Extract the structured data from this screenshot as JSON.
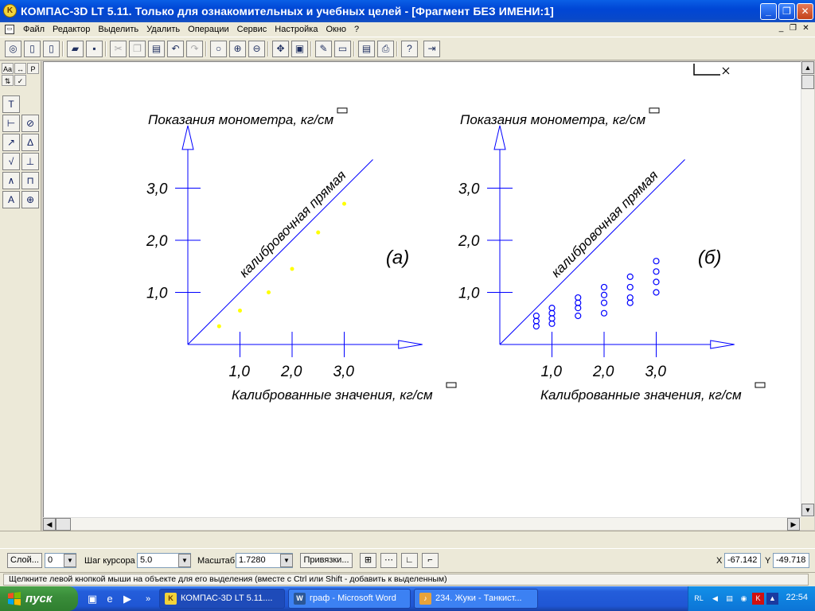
{
  "window": {
    "title": "КОМПАС-3D LT 5.11. Только для ознакомительных и учебных целей - [Фрагмент БЕЗ ИМЕНИ:1]",
    "minimize_glyph": "_",
    "maximize_glyph": "❐",
    "close_glyph": "✕"
  },
  "menu": {
    "items": [
      "Файл",
      "Редактор",
      "Выделить",
      "Удалить",
      "Операции",
      "Сервис",
      "Настройка",
      "Окно",
      "?"
    ]
  },
  "chart_data": [
    {
      "type": "scatter",
      "title": "",
      "panel_label": "(а)",
      "xlabel": "Калиброванные значения, кг/см",
      "ylabel": "Показания монометра, кг/см",
      "x_ticks": [
        "1,0",
        "2,0",
        "3,0"
      ],
      "y_ticks": [
        "1,0",
        "2,0",
        "3,0"
      ],
      "xlim": [
        0,
        4.5
      ],
      "ylim": [
        0,
        4.2
      ],
      "diagonal_label": "калибровочная прямая",
      "diagonal": {
        "x": [
          0,
          3.55
        ],
        "y": [
          0,
          3.55
        ]
      },
      "marker": "dot",
      "marker_color": "#ffff00",
      "points": [
        {
          "x": 0.6,
          "y": 0.35
        },
        {
          "x": 1.0,
          "y": 0.65
        },
        {
          "x": 1.55,
          "y": 1.0
        },
        {
          "x": 2.0,
          "y": 1.45
        },
        {
          "x": 2.5,
          "y": 2.15
        },
        {
          "x": 3.0,
          "y": 2.7
        }
      ]
    },
    {
      "type": "scatter",
      "title": "",
      "panel_label": "(б)",
      "xlabel": "Калиброванные значения, кг/см",
      "ylabel": "Показания монометра, кг/см",
      "x_ticks": [
        "1,0",
        "2,0",
        "3,0"
      ],
      "y_ticks": [
        "1,0",
        "2,0",
        "3,0"
      ],
      "xlim": [
        0,
        4.5
      ],
      "ylim": [
        0,
        4.2
      ],
      "diagonal_label": "калибровочная прямая",
      "diagonal": {
        "x": [
          0,
          3.55
        ],
        "y": [
          0,
          3.55
        ]
      },
      "marker": "circle",
      "marker_color": "#0000ff",
      "points": [
        {
          "x": 0.7,
          "y": 0.35
        },
        {
          "x": 0.7,
          "y": 0.45
        },
        {
          "x": 0.7,
          "y": 0.55
        },
        {
          "x": 1.0,
          "y": 0.4
        },
        {
          "x": 1.0,
          "y": 0.5
        },
        {
          "x": 1.0,
          "y": 0.6
        },
        {
          "x": 1.0,
          "y": 0.7
        },
        {
          "x": 1.5,
          "y": 0.55
        },
        {
          "x": 1.5,
          "y": 0.7
        },
        {
          "x": 1.5,
          "y": 0.8
        },
        {
          "x": 1.5,
          "y": 0.9
        },
        {
          "x": 2.0,
          "y": 0.6
        },
        {
          "x": 2.0,
          "y": 0.8
        },
        {
          "x": 2.0,
          "y": 0.95
        },
        {
          "x": 2.0,
          "y": 1.1
        },
        {
          "x": 2.5,
          "y": 0.8
        },
        {
          "x": 2.5,
          "y": 0.9
        },
        {
          "x": 2.5,
          "y": 1.1
        },
        {
          "x": 2.5,
          "y": 1.3
        },
        {
          "x": 3.0,
          "y": 1.0
        },
        {
          "x": 3.0,
          "y": 1.2
        },
        {
          "x": 3.0,
          "y": 1.4
        },
        {
          "x": 3.0,
          "y": 1.6
        }
      ]
    }
  ],
  "props": {
    "layer_label": "Слой...",
    "layer_value": "0",
    "step_label": "Шаг курсора",
    "step_value": "5.0",
    "scale_label": "Масштаб",
    "scale_value": "1.7280",
    "snaps_label": "Привязки...",
    "x_label": "X",
    "x_value": "-67.142",
    "y_label": "Y",
    "y_value": "-49.718"
  },
  "status": {
    "text": "Щелкните левой кнопкой мыши на объекте для его выделения (вместе с Ctrl или Shift - добавить к выделенным)"
  },
  "taskbar": {
    "start_label": "пуск",
    "tasks": [
      {
        "label": "КОМПАС-3D LT 5.11....",
        "icon_color": "#f3d33a",
        "icon_text": "K"
      },
      {
        "label": "граф - Microsoft Word",
        "icon_color": "#2b5797",
        "icon_text": "W"
      },
      {
        "label": "234. Жуки - Танкист...",
        "icon_color": "#e8a33a",
        "icon_text": "♪"
      }
    ],
    "tray_lang": "RL",
    "clock": "22:54"
  }
}
